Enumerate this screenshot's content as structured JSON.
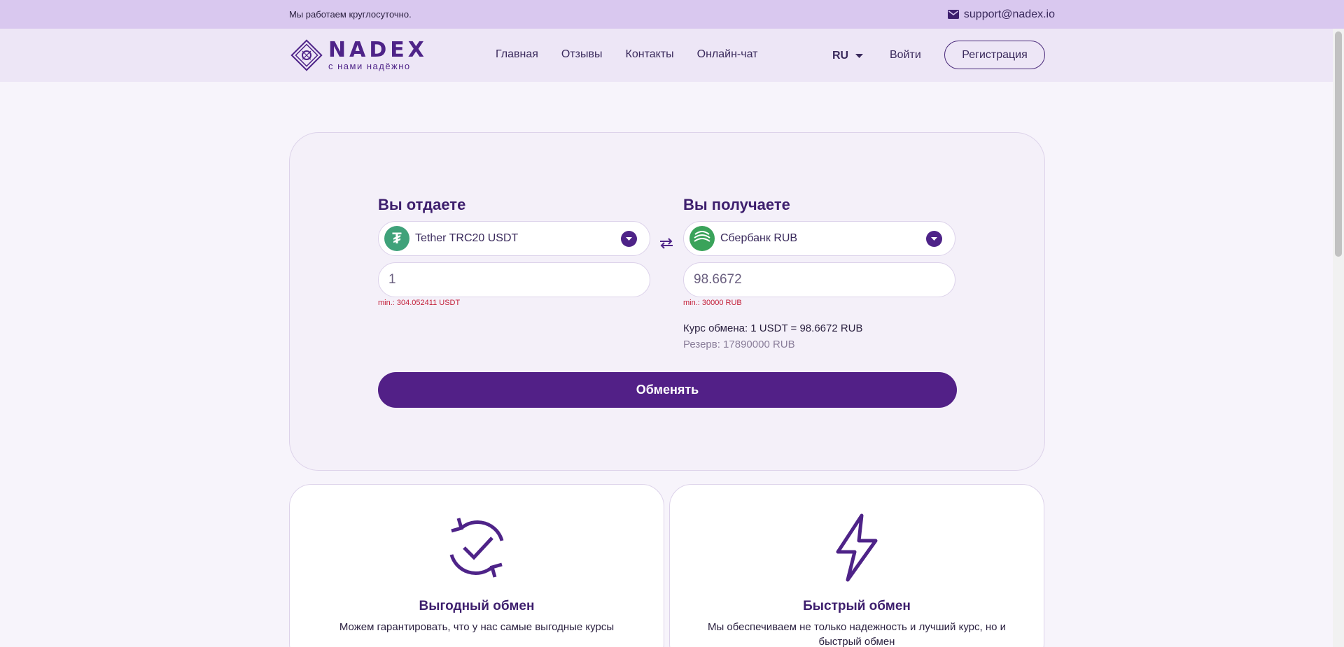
{
  "topbar": {
    "notice": "Мы работаем круглосуточно.",
    "email": "support@nadex.io"
  },
  "logo": {
    "brand": "NADEX",
    "tagline": "с нами надёжно"
  },
  "nav": {
    "items": [
      "Главная",
      "Отзывы",
      "Контакты",
      "Онлайн-чат"
    ]
  },
  "header": {
    "lang": "RU",
    "login": "Войти",
    "register": "Регистрация"
  },
  "exchange": {
    "give": {
      "title": "Вы отдаете",
      "currency": "Tether TRC20 USDT",
      "amount": "1",
      "min": "min.: 304.052411 USDT"
    },
    "get": {
      "title": "Вы получаете",
      "currency": "Сбербанк RUB",
      "amount": "98.6672",
      "min": "min.: 30000 RUB"
    },
    "rate": "Курс обмена: 1 USDT = 98.6672 RUB",
    "reserve": "Резерв: 17890000 RUB",
    "button": "Обменять"
  },
  "features": [
    {
      "title": "Выгодный обмен",
      "text": "Можем гарантировать, что у нас самые выгодные курсы"
    },
    {
      "title": "Быстрый обмен",
      "text": "Мы обеспечиваем не только надежность и лучший курс, но и быстрый обмен"
    }
  ],
  "colors": {
    "brand": "#522087",
    "topbar": "#d9c8ef",
    "header": "#ede6f6",
    "error": "#c3203a"
  }
}
